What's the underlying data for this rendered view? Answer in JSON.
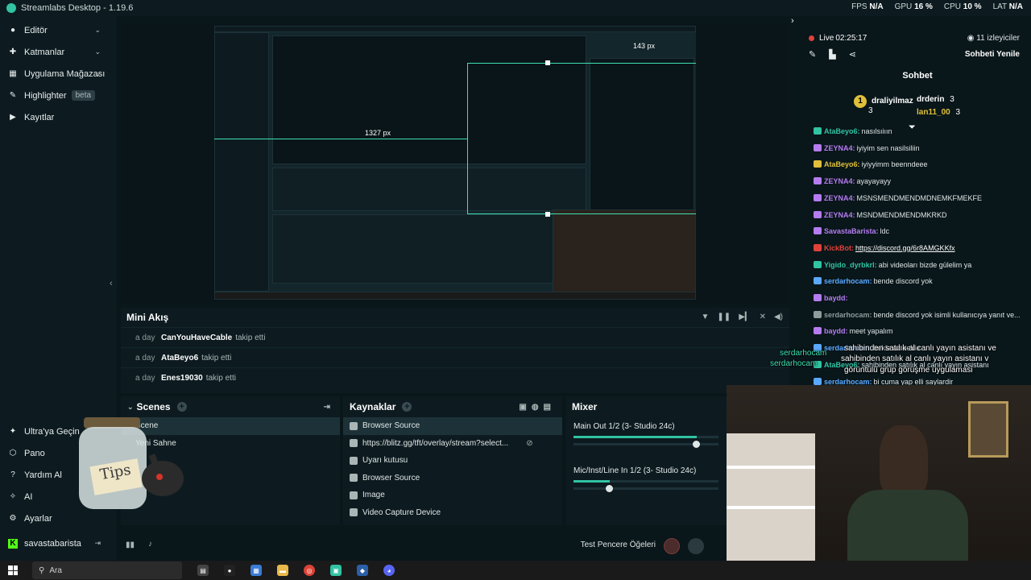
{
  "app": {
    "title": "Streamlabs Desktop - 1.19.6",
    "stats": [
      {
        "label": "FPS",
        "value": "N/A"
      },
      {
        "label": "GPU",
        "value": "16 %"
      },
      {
        "label": "CPU",
        "value": "10 %"
      },
      {
        "label": "LAT",
        "value": "N/A"
      }
    ]
  },
  "sidebar": {
    "items": [
      {
        "label": "Editör",
        "icon": "editor-icon",
        "expandable": true
      },
      {
        "label": "Katmanlar",
        "icon": "layers-icon",
        "expandable": true
      },
      {
        "label": "Uygulama Mağazası",
        "icon": "store-icon",
        "expandable": true
      },
      {
        "label": "Highlighter",
        "icon": "highlighter-icon",
        "badge": "beta"
      },
      {
        "label": "Kayıtlar",
        "icon": "recordings-icon"
      }
    ],
    "bottom": [
      {
        "label": "Ultra'ya Geçin",
        "icon": "ultra-icon"
      },
      {
        "label": "Pano",
        "icon": "dashboard-icon"
      },
      {
        "label": "Yardım Al",
        "icon": "help-icon"
      },
      {
        "label": "AI",
        "icon": "ai-icon"
      },
      {
        "label": "Ayarlar",
        "icon": "settings-icon"
      }
    ],
    "user": "savastabarista"
  },
  "preview": {
    "measure_left": "1327 px",
    "measure_top": "143 px"
  },
  "mini_feed": {
    "title": "Mini Akış",
    "events": [
      {
        "when": "a day",
        "who": "CanYouHaveCable",
        "what": "takip etti"
      },
      {
        "when": "a day",
        "who": "AtaBeyo6",
        "what": "takip etti"
      },
      {
        "when": "a day",
        "who": "Enes19030",
        "what": "takip etti"
      }
    ]
  },
  "scenes": {
    "title": "Scenes",
    "items": [
      "Scene",
      "Yeni Sahne"
    ]
  },
  "sources": {
    "title": "Kaynaklar",
    "items": [
      {
        "label": "Browser Source",
        "icon": "globe-icon",
        "selected": true
      },
      {
        "label": "https://blitz.gg/tft/overlay/stream?select...",
        "icon": "globe-icon"
      },
      {
        "label": "Uyarı kutusu",
        "icon": "alert-icon"
      },
      {
        "label": "Browser Source",
        "icon": "globe-icon"
      },
      {
        "label": "Image",
        "icon": "image-icon"
      },
      {
        "label": "Video Capture Device",
        "icon": "camera-icon"
      }
    ]
  },
  "mixer": {
    "title": "Mixer",
    "channels": [
      {
        "label": "Main Out 1/2 (3- Studio 24c)",
        "level": 0.85
      },
      {
        "label": "Mic/Inst/Line In 1/2 (3- Studio 24c)",
        "level": 0.25
      }
    ]
  },
  "footer": {
    "test_label": "Test Pencere Öğeleri"
  },
  "chat": {
    "live_label": "Live",
    "live_time": "02:25:17",
    "viewers": "11 izleyiciler",
    "refresh": "Sohbeti Yenile",
    "title": "Sohbet",
    "leaders": [
      {
        "name": "draliyilmaz",
        "count": "3",
        "rank": "1"
      },
      {
        "name": "drderin",
        "count": "3"
      },
      {
        "name": "lan11_00",
        "count": "3"
      }
    ],
    "messages": [
      {
        "user": "AtaBeyo6:",
        "text": "nasılsıiıın",
        "color": "#31c3a2"
      },
      {
        "user": "ZEYNA4:",
        "text": "iyiyim sen nasilsiliin",
        "color": "#b57cf0"
      },
      {
        "user": "AtaBeyo6:",
        "text": "iyiyyimm beenndeee",
        "color": "#e0c03a"
      },
      {
        "user": "ZEYNA4:",
        "text": "ayayayayy",
        "color": "#b57cf0"
      },
      {
        "user": "ZEYNA4:",
        "text": "MSNSMENDMENDMDNEMKFMEKFE",
        "color": "#b57cf0"
      },
      {
        "user": "ZEYNA4:",
        "text": "MSNDMENDMENDMKRKD",
        "color": "#b57cf0"
      },
      {
        "user": "SavastaBarista:",
        "text": "ldc",
        "color": "#b57cf0"
      },
      {
        "user": "KickBot:",
        "text": "https://discord.gg/6r8AMGKKfx",
        "color": "#e0423a"
      },
      {
        "user": "Yigido_dyrbkrl:",
        "text": "abi videoları bizde gülelim ya",
        "color": "#31c3a2"
      },
      {
        "user": "serdarhocam:",
        "text": "bende discord yok",
        "color": "#5aa8ff"
      },
      {
        "user": "baydd:",
        "text": "",
        "color": "#b57cf0"
      },
      {
        "user": "serdarhocam:",
        "text": "bende discord yok isimli kullanıcıya yanıt ve...",
        "color": "#8e9b9b"
      },
      {
        "user": "baydd:",
        "text": "meet yapalım",
        "color": "#b57cf0"
      },
      {
        "user": "serdarhocam:",
        "text": "bekle az bekle",
        "color": "#5aa8ff"
      },
      {
        "user": "AtaBeyo6:",
        "text": "sahibinden satılık al canlı yayın asistanı",
        "color": "#31c3a2"
      },
      {
        "user": "serdarhocam:",
        "text": "bi cuma yap elli saylardir",
        "color": "#5aa8ff"
      }
    ]
  },
  "overlays": {
    "tips": "Tips",
    "donation_user": "serdarhocam",
    "ad_text_1": "sahibinden satılık al canlı yayın asistanı ve",
    "ad_text_2": "sahibinden satılık al canlı yayın asistanı v",
    "ad_text_3": "görüntülü grup görüşme uygulamasi"
  },
  "taskbar": {
    "search": "Ara"
  }
}
